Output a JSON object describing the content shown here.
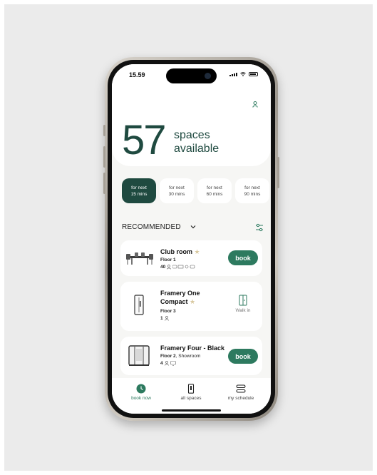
{
  "status_bar": {
    "time": "15.59"
  },
  "header": {
    "count": "57",
    "count_label_line1": "spaces",
    "count_label_line2": "available",
    "profile_icon": "person-icon"
  },
  "filters": [
    {
      "line1": "for next",
      "line2": "15 mins",
      "active": true
    },
    {
      "line1": "for next",
      "line2": "30 mins",
      "active": false
    },
    {
      "line1": "for next",
      "line2": "60 mins",
      "active": false
    },
    {
      "line1": "for next",
      "line2": "90 mins",
      "active": false
    }
  ],
  "recommended": {
    "label": "RECOMMENDED"
  },
  "spaces": [
    {
      "title": "Club room",
      "floor": "Floor 1",
      "floor_extra": "",
      "capacity": "40",
      "action": "book"
    },
    {
      "title_line1": "Framery One",
      "title_line2": "Compact",
      "floor": "Floor 3",
      "capacity": "1",
      "action": "Walk in"
    },
    {
      "title": "Framery Four - Black",
      "floor": "Floor 2",
      "floor_extra": ", Showroom",
      "capacity": "4",
      "action": "book"
    }
  ],
  "tabs": [
    {
      "label": "book now",
      "active": true
    },
    {
      "label": "all spaces",
      "active": false
    },
    {
      "label": "my schedule",
      "active": false
    }
  ],
  "colors": {
    "brand_dark": "#1f4a40",
    "brand": "#2d7a5f",
    "star": "#d9c9a0"
  }
}
